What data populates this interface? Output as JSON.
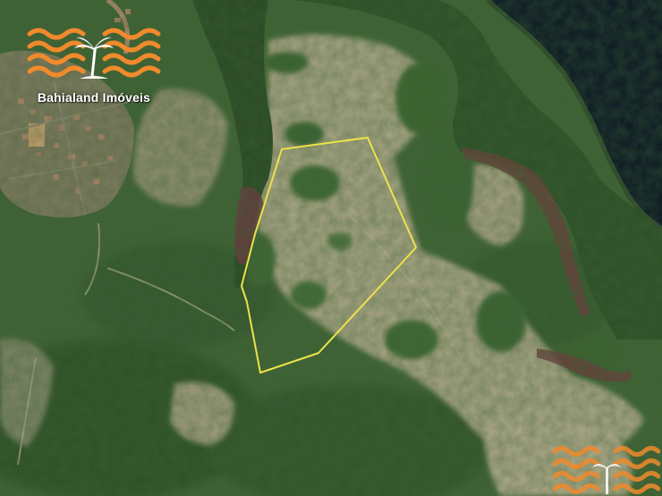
{
  "watermark": {
    "brand_name": "Bahialand Imóveis",
    "logo_color": "#f08a2c"
  },
  "map": {
    "view": "satellite",
    "boundary_color": "#ece34a"
  }
}
